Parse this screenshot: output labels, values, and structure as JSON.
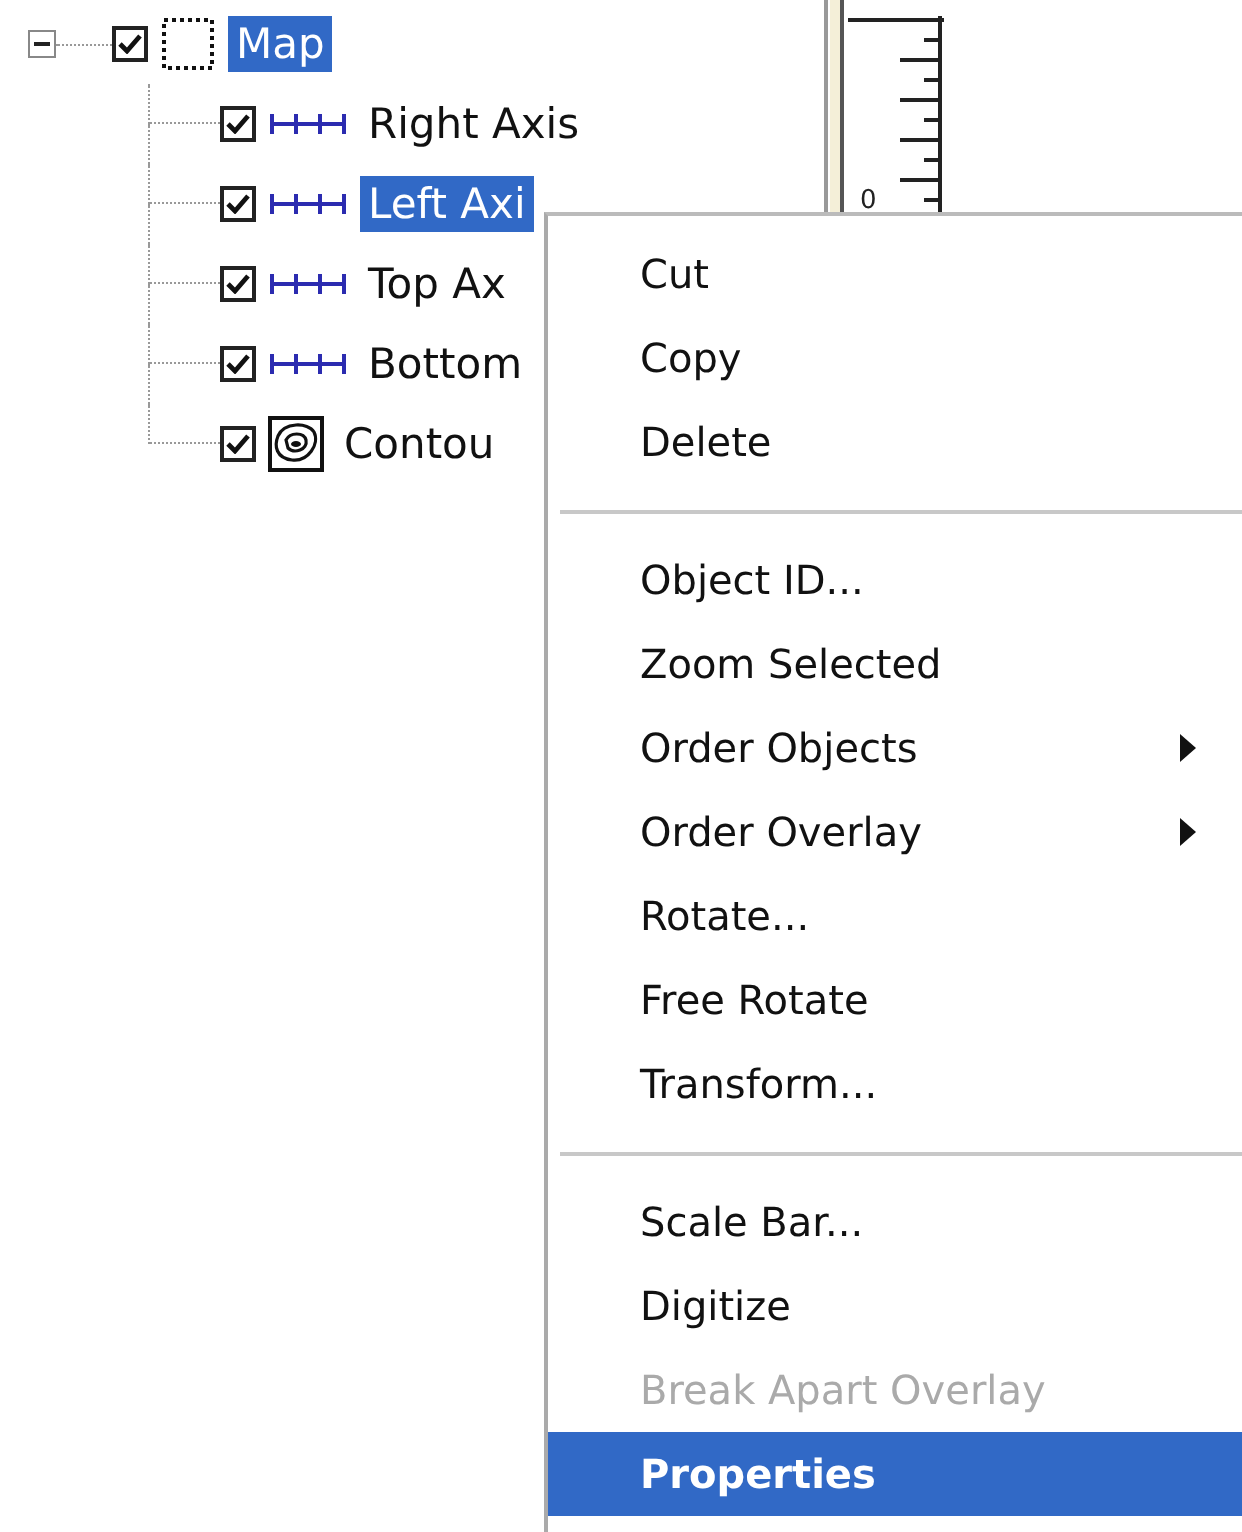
{
  "tree": {
    "label": "Map",
    "expanded": true,
    "checked": true,
    "selected": true,
    "children": [
      {
        "label": "Right Axis",
        "kind": "axis",
        "checked": true,
        "selected": false
      },
      {
        "label": "Left Axi",
        "kind": "axis",
        "checked": true,
        "selected": true
      },
      {
        "label": "Top Ax",
        "kind": "axis",
        "checked": true,
        "selected": false
      },
      {
        "label": "Bottom",
        "kind": "axis",
        "checked": true,
        "selected": false
      },
      {
        "label": "Contou",
        "kind": "contour",
        "checked": true,
        "selected": false
      }
    ]
  },
  "ruler": {
    "label": "0"
  },
  "context_menu": {
    "items": [
      {
        "kind": "item",
        "label": "Cut",
        "disabled": false,
        "selected": false,
        "submenu": false
      },
      {
        "kind": "item",
        "label": "Copy",
        "disabled": false,
        "selected": false,
        "submenu": false
      },
      {
        "kind": "item",
        "label": "Delete",
        "disabled": false,
        "selected": false,
        "submenu": false
      },
      {
        "kind": "separator"
      },
      {
        "kind": "item",
        "label": "Object ID...",
        "disabled": false,
        "selected": false,
        "submenu": false
      },
      {
        "kind": "item",
        "label": "Zoom Selected",
        "disabled": false,
        "selected": false,
        "submenu": false
      },
      {
        "kind": "item",
        "label": "Order Objects",
        "disabled": false,
        "selected": false,
        "submenu": true
      },
      {
        "kind": "item",
        "label": "Order Overlay",
        "disabled": false,
        "selected": false,
        "submenu": true
      },
      {
        "kind": "item",
        "label": "Rotate...",
        "disabled": false,
        "selected": false,
        "submenu": false
      },
      {
        "kind": "item",
        "label": "Free Rotate",
        "disabled": false,
        "selected": false,
        "submenu": false
      },
      {
        "kind": "item",
        "label": "Transform...",
        "disabled": false,
        "selected": false,
        "submenu": false
      },
      {
        "kind": "separator"
      },
      {
        "kind": "item",
        "label": "Scale Bar...",
        "disabled": false,
        "selected": false,
        "submenu": false
      },
      {
        "kind": "item",
        "label": "Digitize",
        "disabled": false,
        "selected": false,
        "submenu": false
      },
      {
        "kind": "item",
        "label": "Break Apart Overlay",
        "disabled": true,
        "selected": false,
        "submenu": false
      },
      {
        "kind": "item",
        "label": "Properties",
        "disabled": false,
        "selected": true,
        "submenu": false,
        "default": true
      }
    ]
  }
}
